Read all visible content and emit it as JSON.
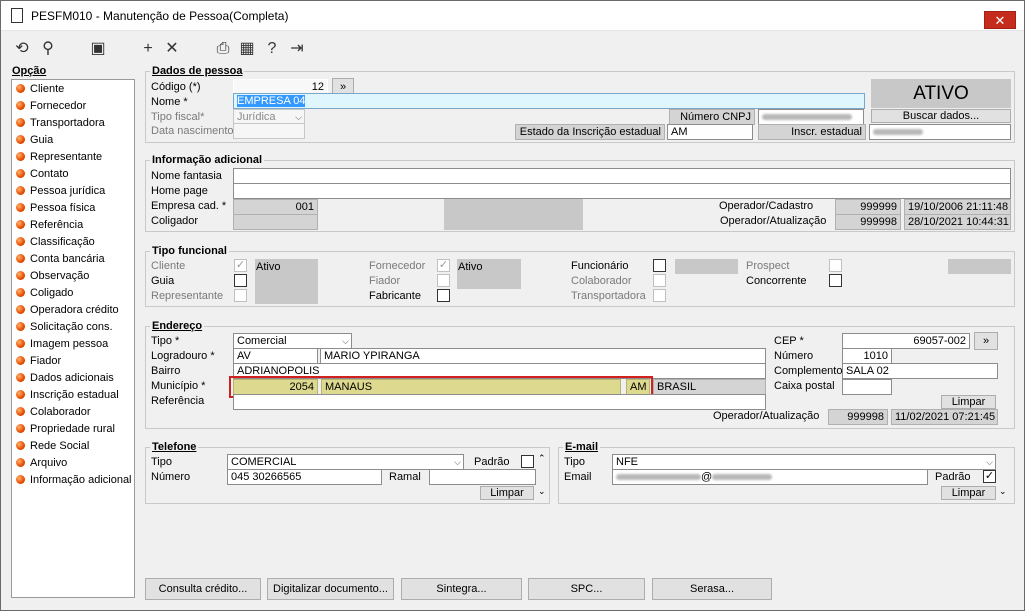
{
  "window": {
    "title": "PESFM010 - Manutenção de Pessoa(Completa)",
    "close": "✕"
  },
  "toolbar": {
    "icons": [
      "refresh-icon",
      "search-icon",
      "save-icon",
      "add-icon",
      "delete-icon",
      "print-icon",
      "calendar-icon",
      "help-icon",
      "exit-icon"
    ]
  },
  "sidebar": {
    "title": "Opção",
    "items": [
      "Cliente",
      "Fornecedor",
      "Transportadora",
      "Guia",
      "Representante",
      "Contato",
      "Pessoa jurídica",
      "Pessoa física",
      "Referência",
      "Classificação",
      "Conta bancária",
      "Observação",
      "Coligado",
      "Operadora crédito",
      "Solicitação cons.",
      "Imagem pessoa",
      "Fiador",
      "Dados adicionais",
      "Inscrição estadual",
      "Colaborador",
      "Propriedade rural",
      "Rede Social",
      "Arquivo",
      "Informação adicional"
    ]
  },
  "dados": {
    "title": "Dados de pessoa",
    "codigo_label": "Código (*)",
    "codigo": "12",
    "codigo_btn": "»",
    "nome_label": "Nome *",
    "nome": "EMPRESA 04",
    "tipo_fiscal_label": "Tipo fiscal*",
    "tipo_fiscal": "Jurídica",
    "data_nasc_label": "Data nascimento",
    "cnpj_label": "Número CNPJ",
    "estado_ie_label": "Estado da Inscrição estadual",
    "estado_ie": "AM",
    "inscr_label": "Inscr. estadual",
    "status": "ATIVO",
    "buscar": "Buscar dados..."
  },
  "info": {
    "title": "Informação adicional",
    "fantasia_label": "Nome fantasia",
    "homepage_label": "Home page",
    "empresa_label": "Empresa cad. *",
    "empresa": "001",
    "coligador_label": "Coligador",
    "op_cad_label": "Operador/Cadastro",
    "op_cad": "999999",
    "op_cad_date": "19/10/2006 21:11:48",
    "op_at_label": "Operador/Atualização",
    "op_at": "999998",
    "op_at_date": "28/10/2021 10:44:31"
  },
  "funcional": {
    "title": "Tipo funcional",
    "cliente": "Cliente",
    "guia": "Guia",
    "representante": "Representante",
    "ativo1": "Ativo",
    "fornecedor": "Fornecedor",
    "fiador": "Fiador",
    "fabricante": "Fabricante",
    "ativo2": "Ativo",
    "funcionario": "Funcionário",
    "colaborador": "Colaborador",
    "transportadora": "Transportadora",
    "prospect": "Prospect",
    "concorrente": "Concorrente",
    "check": "✓"
  },
  "endereco": {
    "title": "Endereço",
    "tipo_label": "Tipo *",
    "tipo": "Comercial",
    "logradouro_label": "Logradouro *",
    "logradouro_tipo": "AV",
    "logradouro": "MARIO YPIRANGA",
    "bairro_label": "Bairro",
    "bairro": "ADRIANOPOLIS",
    "municipio_label": "Município *",
    "municipio_cod": "2054",
    "municipio": "MANAUS",
    "uf": "AM",
    "pais": "BRASIL",
    "referencia_label": "Referência",
    "cep_label": "CEP *",
    "cep": "69057-002",
    "cep_btn": "»",
    "numero_label": "Número",
    "numero": "1010",
    "complemento_label": "Complemento",
    "complemento": "SALA 02",
    "caixa_label": "Caixa postal",
    "limpar": "Limpar",
    "op_at_label": "Operador/Atualização",
    "op_at": "999998",
    "op_at_date": "11/02/2021 07:21:45"
  },
  "telefone": {
    "title": "Telefone",
    "tipo_label": "Tipo",
    "tipo": "COMERCIAL",
    "padrao_label": "Padrão",
    "numero_label": "Número",
    "numero": "045 30266565",
    "ramal_label": "Ramal",
    "limpar": "Limpar"
  },
  "email": {
    "title": "E-mail",
    "tipo_label": "Tipo",
    "tipo": "NFE",
    "email_label": "Email",
    "email_at": "@",
    "padrao_label": "Padrão",
    "check": "✓",
    "limpar": "Limpar"
  },
  "footer": [
    "Consulta crédito...",
    "Digitalizar documento...",
    "Sintegra...",
    "SPC...",
    "Serasa..."
  ]
}
